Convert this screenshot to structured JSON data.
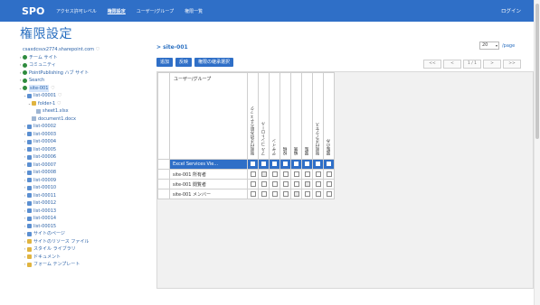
{
  "header": {
    "brand": "SPO",
    "nav": [
      "アクセス許可レベル",
      "権限設定",
      "ユーザー/グループ",
      "権限一覧"
    ],
    "login": "ログイン",
    "accent": "#2f6fc7"
  },
  "page": {
    "title": "権限設定"
  },
  "tree": {
    "items": [
      {
        "toggle": "",
        "icon": "",
        "label": "csaxdcsvx2774.sharepoint.com",
        "ext": "◌",
        "indent": 0,
        "sel": false
      },
      {
        "toggle": "›",
        "icon": "site",
        "label": "チーム サイト",
        "ext": "",
        "indent": 0,
        "sel": false
      },
      {
        "toggle": "›",
        "icon": "site",
        "label": "コミュニティ",
        "ext": "",
        "indent": 0,
        "sel": false
      },
      {
        "toggle": "›",
        "icon": "site",
        "label": "PointPublishing ハブ サイト",
        "ext": "",
        "indent": 0,
        "sel": false
      },
      {
        "toggle": "›",
        "icon": "site",
        "label": "Search",
        "ext": "",
        "indent": 0,
        "sel": false
      },
      {
        "toggle": "⌄",
        "icon": "site",
        "label": "site-001",
        "ext": "◌",
        "indent": 0,
        "sel": true
      },
      {
        "toggle": "⌄",
        "icon": "list",
        "label": "list-00001",
        "ext": "◌",
        "indent": 1,
        "sel": false
      },
      {
        "toggle": "⌄",
        "icon": "folder",
        "label": "folder-1",
        "ext": "◌",
        "indent": 2,
        "sel": false
      },
      {
        "toggle": "",
        "icon": "file",
        "label": "sheet1.xlsx",
        "ext": "",
        "indent": 3,
        "sel": false
      },
      {
        "toggle": "",
        "icon": "file",
        "label": "document1.docx",
        "ext": "",
        "indent": 2,
        "sel": false
      },
      {
        "toggle": "›",
        "icon": "list",
        "label": "list-00002",
        "ext": "",
        "indent": 1,
        "sel": false
      },
      {
        "toggle": "›",
        "icon": "list",
        "label": "list-00003",
        "ext": "",
        "indent": 1,
        "sel": false
      },
      {
        "toggle": "›",
        "icon": "list",
        "label": "list-00004",
        "ext": "",
        "indent": 1,
        "sel": false
      },
      {
        "toggle": "›",
        "icon": "list",
        "label": "list-00005",
        "ext": "",
        "indent": 1,
        "sel": false
      },
      {
        "toggle": "›",
        "icon": "list",
        "label": "list-00006",
        "ext": "",
        "indent": 1,
        "sel": false
      },
      {
        "toggle": "›",
        "icon": "list",
        "label": "list-00007",
        "ext": "",
        "indent": 1,
        "sel": false
      },
      {
        "toggle": "›",
        "icon": "list",
        "label": "list-00008",
        "ext": "",
        "indent": 1,
        "sel": false
      },
      {
        "toggle": "›",
        "icon": "list",
        "label": "list-00009",
        "ext": "",
        "indent": 1,
        "sel": false
      },
      {
        "toggle": "›",
        "icon": "list",
        "label": "list-00010",
        "ext": "",
        "indent": 1,
        "sel": false
      },
      {
        "toggle": "›",
        "icon": "list",
        "label": "list-00011",
        "ext": "",
        "indent": 1,
        "sel": false
      },
      {
        "toggle": "›",
        "icon": "list",
        "label": "list-00012",
        "ext": "",
        "indent": 1,
        "sel": false
      },
      {
        "toggle": "›",
        "icon": "list",
        "label": "list-00013",
        "ext": "",
        "indent": 1,
        "sel": false
      },
      {
        "toggle": "›",
        "icon": "list",
        "label": "list-00014",
        "ext": "",
        "indent": 1,
        "sel": false
      },
      {
        "toggle": "›",
        "icon": "list",
        "label": "list-00015",
        "ext": "",
        "indent": 1,
        "sel": false
      },
      {
        "toggle": "›",
        "icon": "list",
        "label": "サイトのページ",
        "ext": "",
        "indent": 1,
        "sel": false
      },
      {
        "toggle": "›",
        "icon": "folder",
        "label": "サイトのリソース ファイル",
        "ext": "",
        "indent": 1,
        "sel": false
      },
      {
        "toggle": "›",
        "icon": "folder",
        "label": "スタイル ライブラリ",
        "ext": "",
        "indent": 1,
        "sel": false
      },
      {
        "toggle": "›",
        "icon": "folder",
        "label": "ドキュメント",
        "ext": "",
        "indent": 1,
        "sel": false
      },
      {
        "toggle": "›",
        "icon": "folder",
        "label": "フォーム テンプレート",
        "ext": "",
        "indent": 1,
        "sel": false
      }
    ]
  },
  "main": {
    "site_name": "> site-001",
    "buttons": [
      "追加",
      "反映",
      "権限の継承選択"
    ],
    "page_size": {
      "value": "20",
      "unit": "/page"
    },
    "pager": [
      "<<",
      "<",
      "1 / 1",
      ">",
      ">>"
    ]
  },
  "grid": {
    "group_header": "ユーザー/グループ",
    "columns": [
      "制限付き読み取りチェック",
      "フル コントロール",
      "デザイン",
      "投稿",
      "編集",
      "閲覧",
      "制限付きアクセス",
      "閲覧のみ"
    ],
    "rows": [
      {
        "label": "Excel Services Vie...",
        "highlight": true,
        "checks": [
          false,
          false,
          false,
          false,
          false,
          false,
          false,
          true
        ]
      },
      {
        "label": "site-001 所有者",
        "highlight": false,
        "checks": [
          false,
          true,
          false,
          false,
          false,
          false,
          false,
          false
        ]
      },
      {
        "label": "site-001 閲覧者",
        "highlight": false,
        "checks": [
          false,
          false,
          false,
          false,
          false,
          true,
          false,
          false
        ]
      },
      {
        "label": "site-001 メンバー",
        "highlight": false,
        "checks": [
          false,
          false,
          false,
          false,
          true,
          false,
          false,
          false
        ]
      }
    ]
  }
}
